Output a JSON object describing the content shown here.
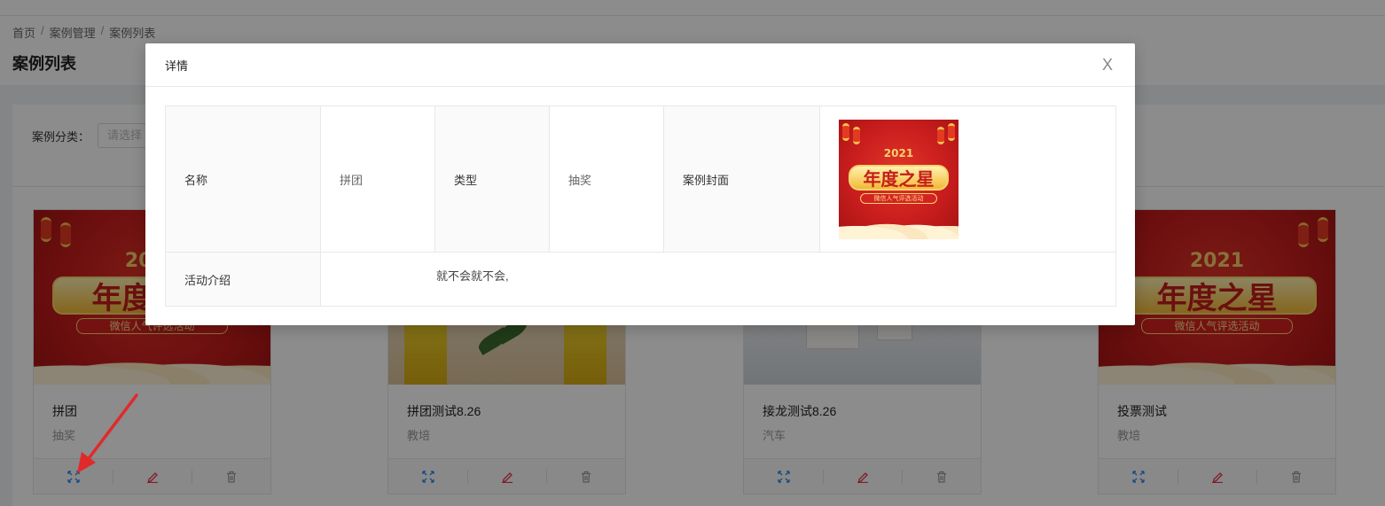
{
  "breadcrumb": [
    "首页",
    "案例管理",
    "案例列表"
  ],
  "breadcrumb_separator": "/",
  "page_title": "案例列表",
  "filter": {
    "label": "案例分类：",
    "placeholder": "请选择"
  },
  "cover_text": {
    "year": "2021",
    "title": "年度之星",
    "subtitle": "微信人气评选活动"
  },
  "cards": [
    {
      "name": "拼团",
      "type": "抽奖",
      "cover": "poster"
    },
    {
      "name": "拼团测试8.26",
      "type": "教培",
      "cover": "product"
    },
    {
      "name": "接龙测试8.26",
      "type": "汽车",
      "cover": "gift"
    },
    {
      "name": "投票测试",
      "type": "教培",
      "cover": "poster"
    }
  ],
  "card_action_icons": [
    "expand-icon",
    "edit-icon",
    "delete-icon"
  ],
  "colors": {
    "action_blue": "#2d8cf0",
    "action_red": "#e8384f",
    "action_gray": "#999999",
    "arrow_red": "#e02a2a"
  },
  "modal": {
    "title": "详情",
    "close": "X",
    "rows": {
      "name_label": "名称",
      "name_value": "拼团",
      "type_label": "类型",
      "type_value": "抽奖",
      "cover_label": "案例封面",
      "intro_label": "活动介绍",
      "intro_value": "就不会就不会,"
    }
  }
}
